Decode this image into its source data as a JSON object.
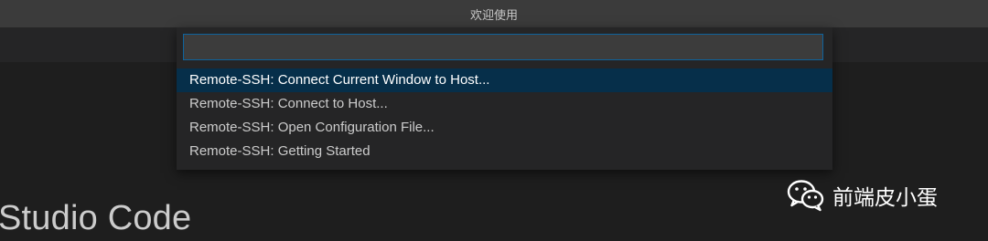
{
  "window": {
    "title": "欢迎使用"
  },
  "welcome": {
    "heading": "Studio Code"
  },
  "quick_open": {
    "input_value": "",
    "items": [
      {
        "label": "Remote-SSH: Connect Current Window to Host...",
        "selected": true
      },
      {
        "label": "Remote-SSH: Connect to Host...",
        "selected": false
      },
      {
        "label": "Remote-SSH: Open Configuration File...",
        "selected": false
      },
      {
        "label": "Remote-SSH: Getting Started",
        "selected": false
      }
    ]
  },
  "watermark": {
    "text": "前端皮小蛋",
    "icon": "wechat-icon"
  },
  "colors": {
    "titlebar": "#3b3b3b",
    "editor_background": "#1e1e1e",
    "panel": "#252526",
    "input_border": "#0e639c",
    "selected_item": "#062f4a"
  }
}
